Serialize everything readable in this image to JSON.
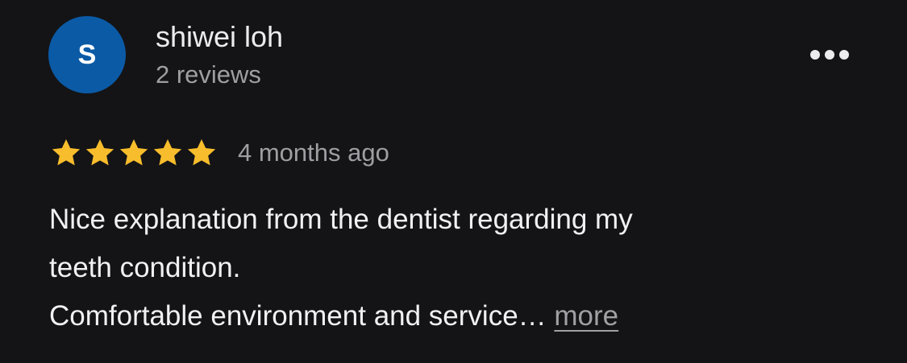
{
  "review": {
    "author": {
      "avatar_initial": "S",
      "avatar_color": "#0b5aa6",
      "name": "shiwei loh",
      "meta": "2 reviews"
    },
    "menu_icon": "more-horizontal-icon",
    "rating": {
      "stars": 5,
      "max": 5,
      "star_color": "#f8bd2c",
      "icon": "star-icon"
    },
    "time_ago": "4 months ago",
    "body": {
      "line1": "Nice explanation from the dentist regarding my",
      "line2": "teeth condition.",
      "line3": "Comfortable environment and service…",
      "more_label": "more"
    }
  }
}
